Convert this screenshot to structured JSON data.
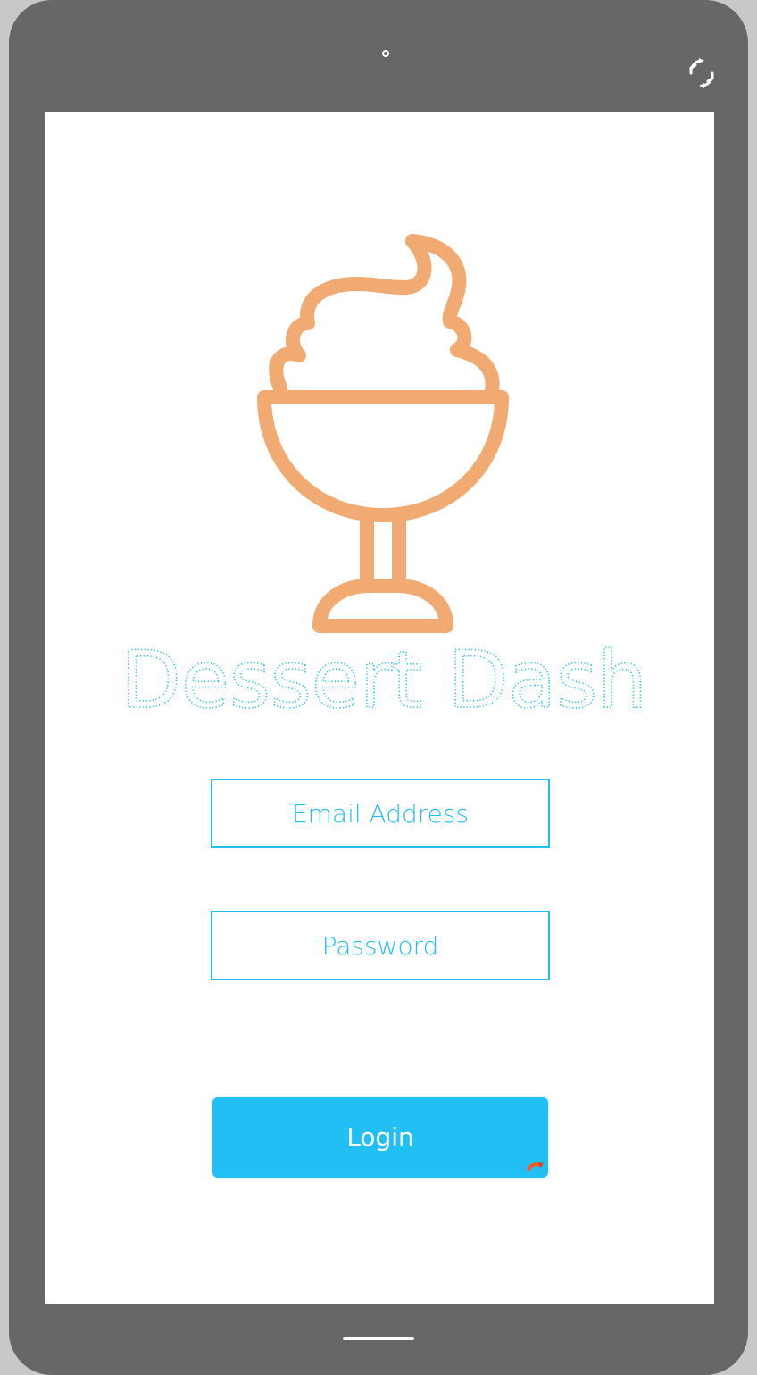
{
  "app": {
    "title": "Dessert Dash",
    "logo_icon": "sundae-cup-icon"
  },
  "form": {
    "email_placeholder": "Email Address",
    "email_value": "",
    "password_placeholder": "Password",
    "password_value": "",
    "login_label": "Login"
  },
  "device": {
    "rotate_icon": "rotate-icon",
    "camera_icon": "camera-dot"
  },
  "colors": {
    "accent": "#22bff4",
    "logo": "#f0aa72",
    "device_frame": "#676767",
    "background": "#ffffff"
  }
}
